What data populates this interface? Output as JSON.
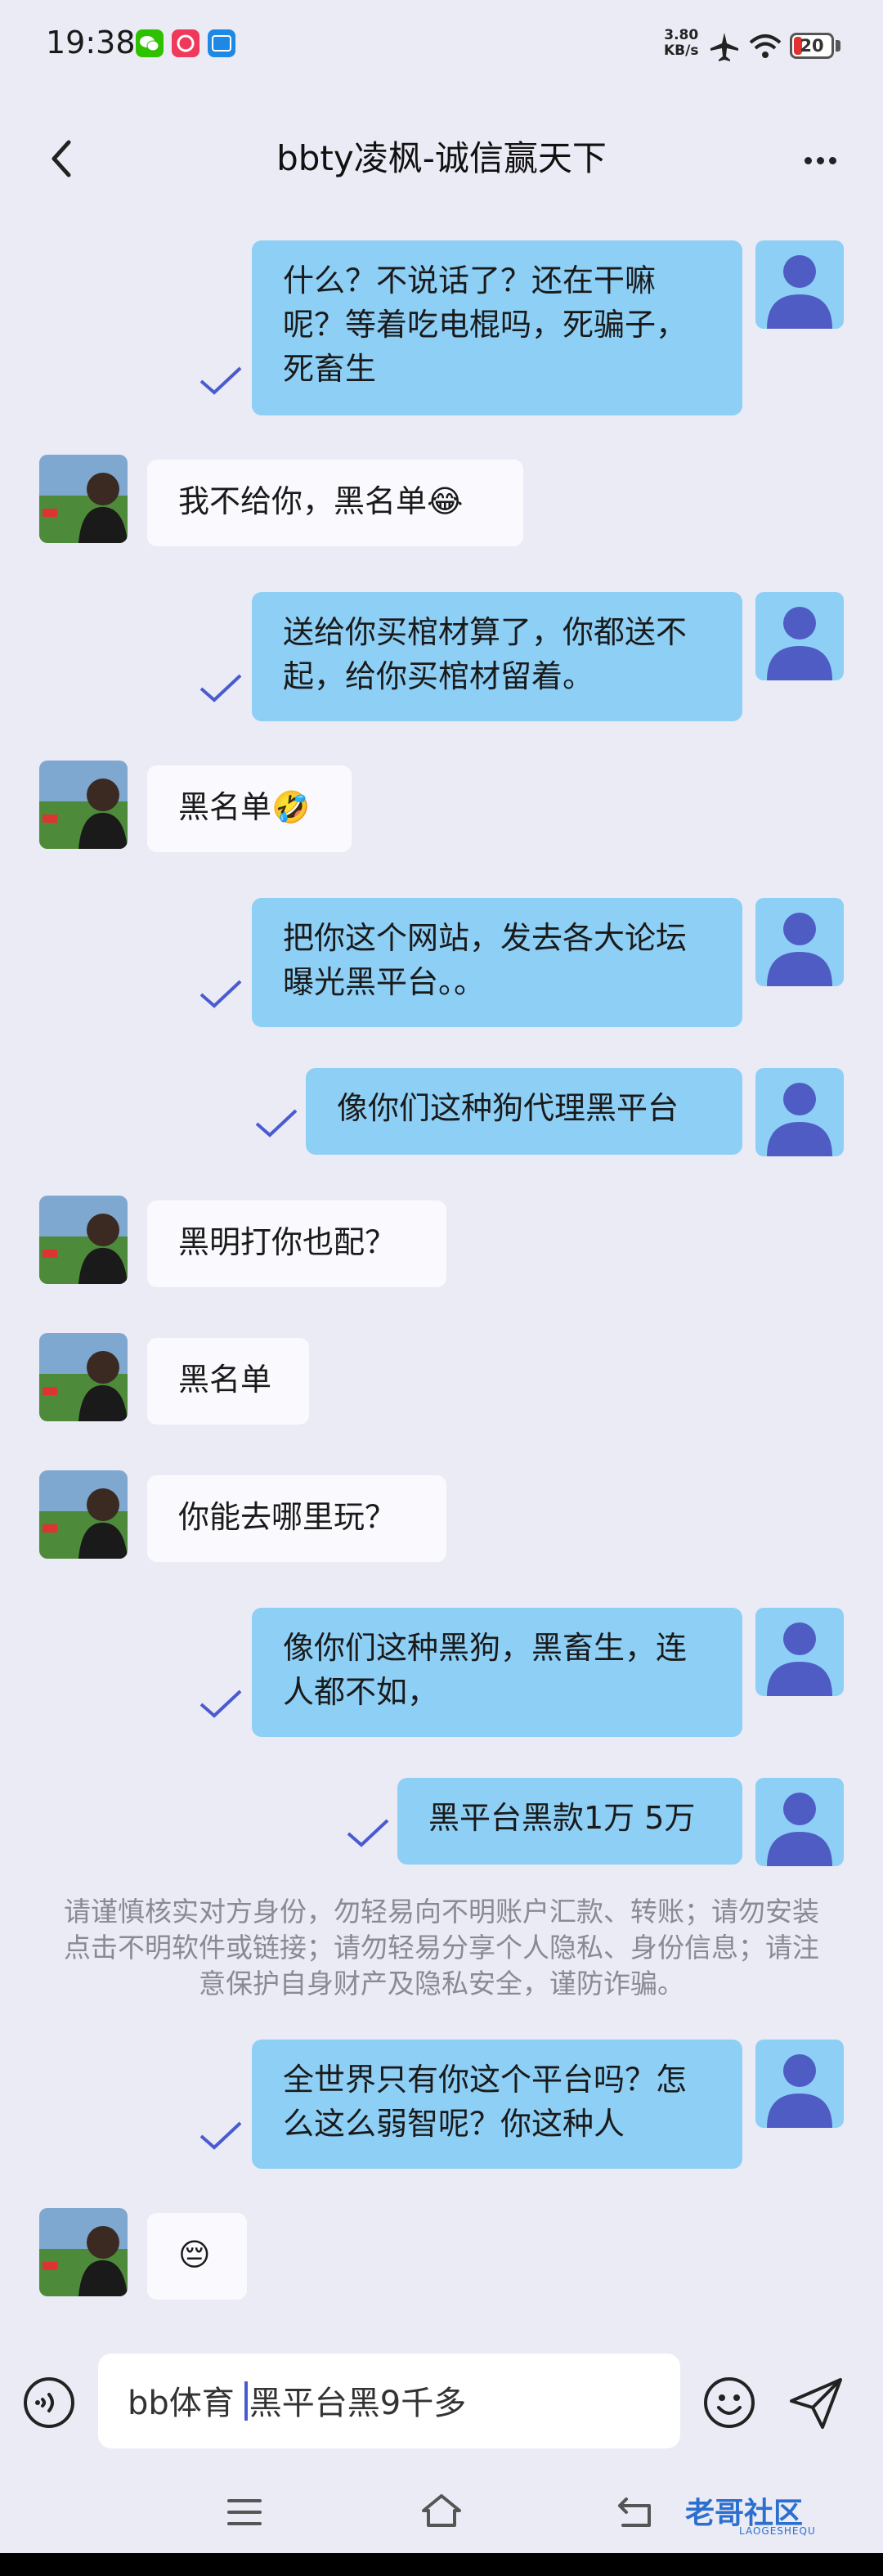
{
  "status": {
    "time": "19:38",
    "net_speed": "3.80",
    "net_unit": "KB/s",
    "battery": "20"
  },
  "header": {
    "title": "bbty凌枫-诚信赢天下"
  },
  "messages": [
    {
      "side": "out",
      "text": "什么？不说话了？还在干嘛呢？等着吃电棍吗，死骗子，死畜生",
      "read": true
    },
    {
      "side": "in",
      "text": "我不给你，黑名单😂"
    },
    {
      "side": "out",
      "text": "送给你买棺材算了，你都送不起，给你买棺材留着。",
      "read": true
    },
    {
      "side": "in",
      "text": "黑名单🤣"
    },
    {
      "side": "out",
      "text": "把你这个网站，发去各大论坛曝光黑平台。。",
      "read": true
    },
    {
      "side": "out",
      "text": "像你们这种狗代理黑平台",
      "read": true
    },
    {
      "side": "in",
      "text": "黑明打你也配？"
    },
    {
      "side": "in",
      "text": "黑名单"
    },
    {
      "side": "in",
      "text": "你能去哪里玩？"
    },
    {
      "side": "out",
      "text": "像你们这种黑狗，黑畜生，连人都不如，",
      "read": true
    },
    {
      "side": "out",
      "text": "黑平台黑款1万 5万",
      "read": true
    },
    {
      "side": "out",
      "text": "全世界只有你这个平台吗？怎么这么弱智呢？你这种人",
      "read": true
    },
    {
      "side": "in",
      "text": "😔"
    }
  ],
  "notice": "请谨慎核实对方身份，勿轻易向不明账户汇款、转账；请勿安装点击不明软件或链接；请勿轻易分享个人隐私、身份信息；请注意保护自身财产及隐私安全，谨防诈骗。",
  "input": {
    "prefix": "bb体育",
    "value": "黑平台黑9千多"
  },
  "watermark": {
    "text": "老哥社区",
    "sub": "LAOGESHEQU"
  },
  "colors": {
    "outgoing_bubble": "#8ecff6",
    "incoming_bubble": "#fafafe",
    "background": "#ebebf5",
    "read_check": "#4a5bd0"
  }
}
